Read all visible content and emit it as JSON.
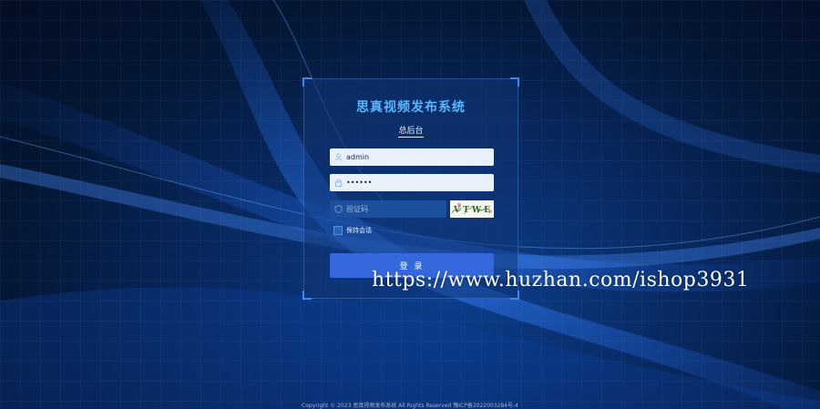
{
  "app": {
    "title": "思真视频发布系统",
    "subtitle": "总后台"
  },
  "login": {
    "username_value": "admin",
    "password_value": "••••••",
    "captcha_placeholder": "验证码",
    "captcha_text": "V T W E",
    "remember_label": "保持会话",
    "submit_label": "登 录"
  },
  "watermark": "https://www.huzhan.com/ishop3931",
  "footer": "Copyright © 2023 思真视频发布系统 All Rights Reserved 豫ICP备2022003284号-4",
  "colors": {
    "title": "#58b6ff",
    "button": "#3668dd",
    "background": "#082a63"
  },
  "icons": [
    "user-icon",
    "lock-icon",
    "shield-icon"
  ]
}
